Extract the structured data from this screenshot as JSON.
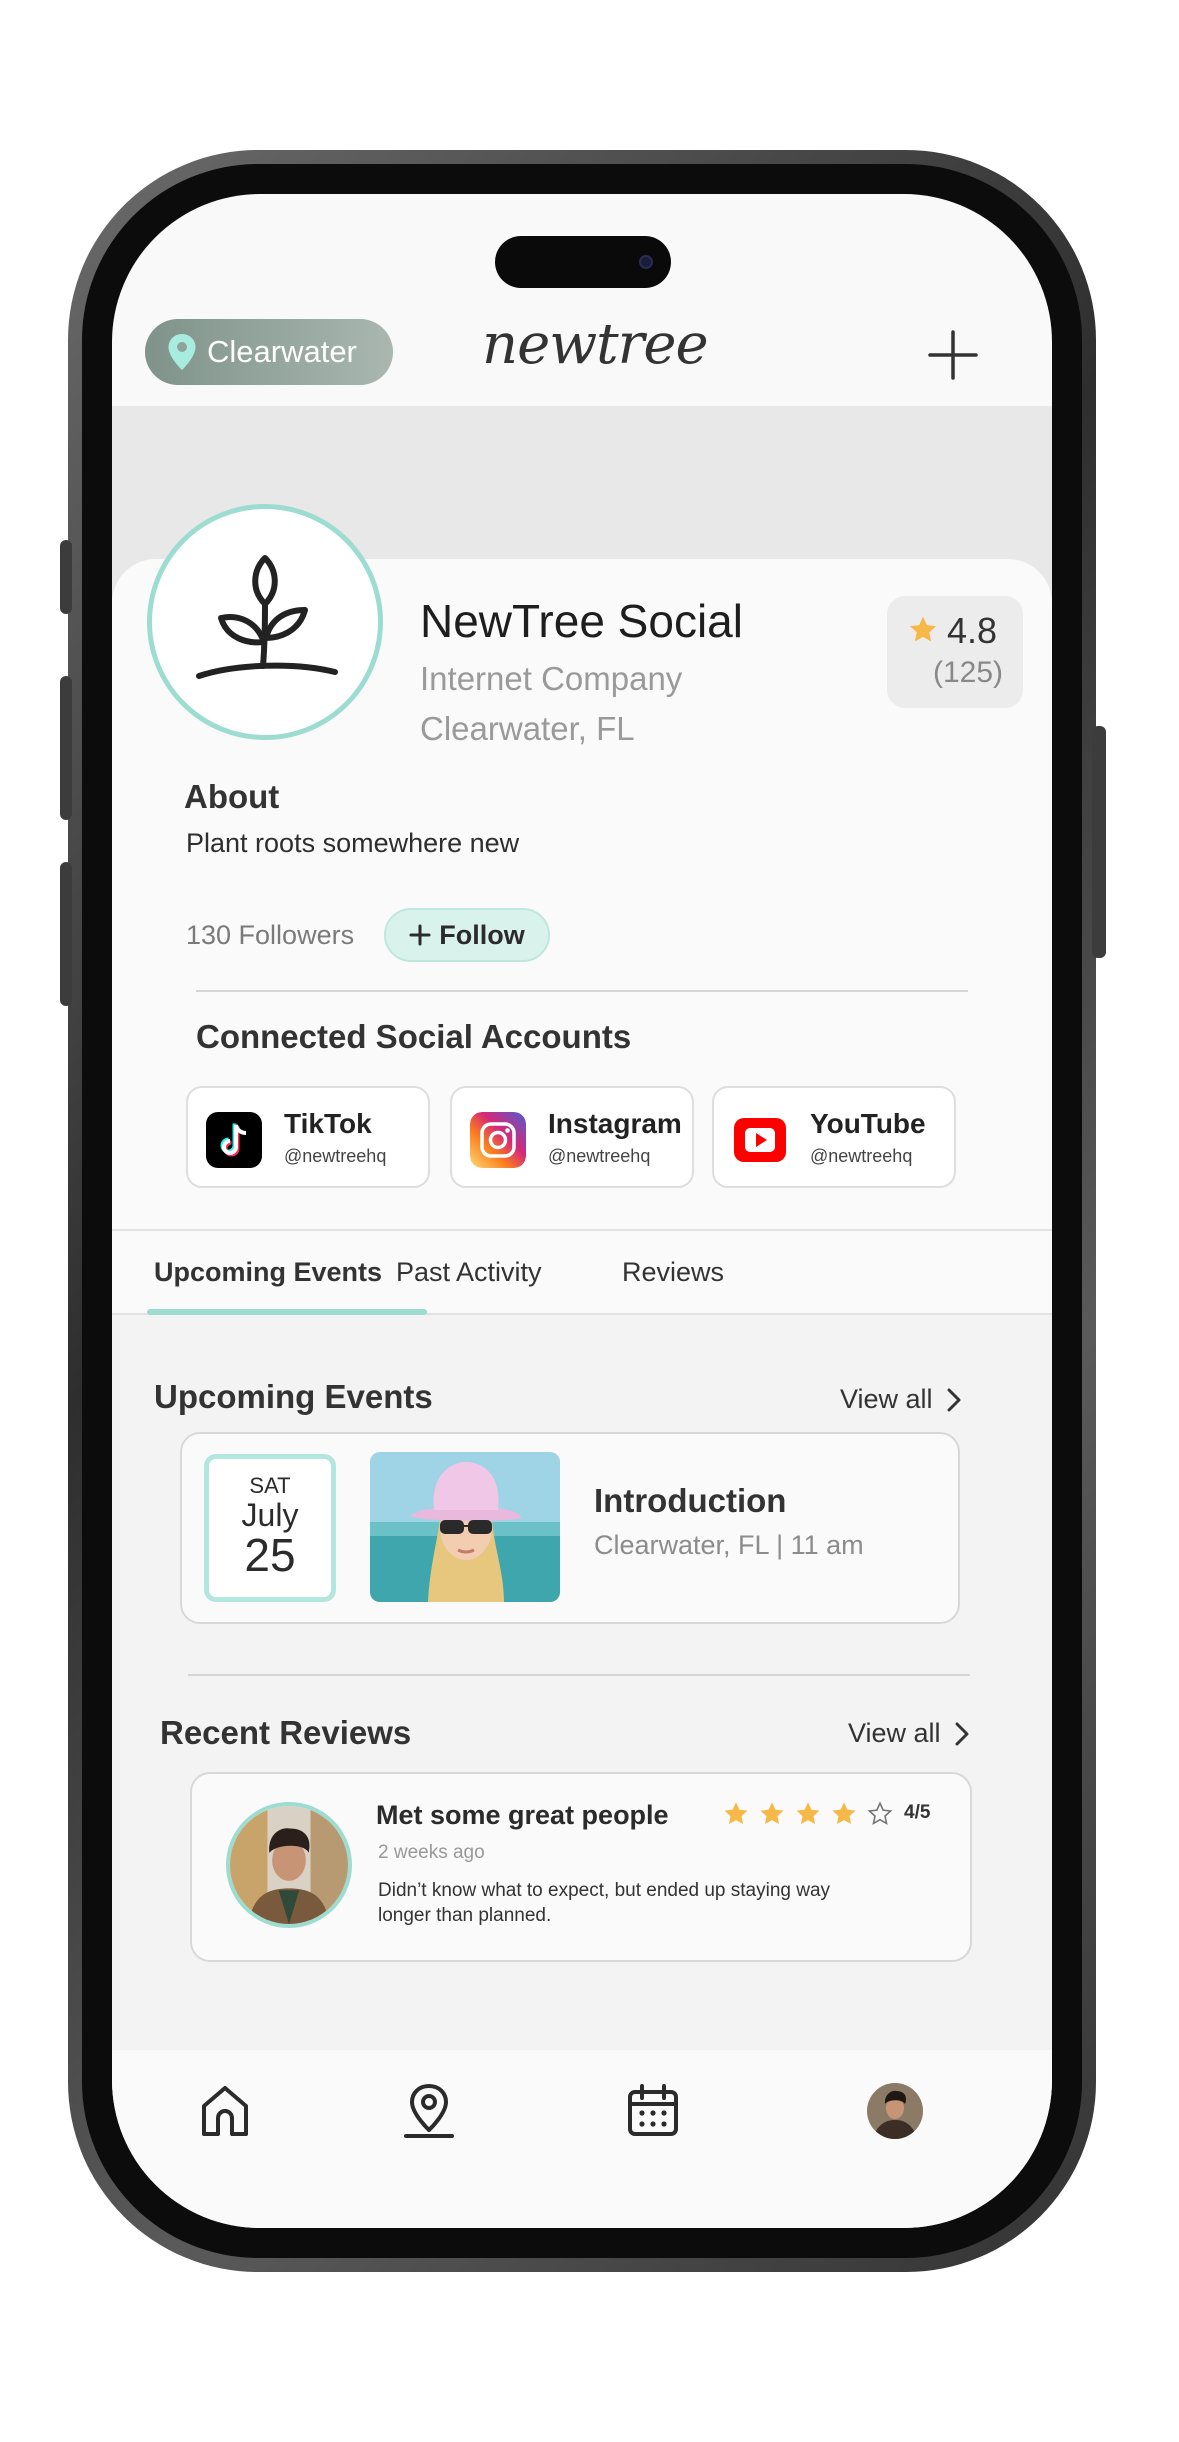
{
  "header": {
    "location": "Clearwater",
    "brand": "newtree"
  },
  "profile": {
    "name": "NewTree Social",
    "category": "Internet Company",
    "location": "Clearwater, FL",
    "rating": "4.8",
    "rating_count": "(125)",
    "about_heading": "About",
    "about_text": "Plant roots somewhere new",
    "followers": "130 Followers",
    "follow_label": "Follow"
  },
  "social": {
    "heading": "Connected Social Accounts",
    "accounts": [
      {
        "name": "TikTok",
        "handle": "@newtreehq",
        "icon": "tiktok-icon"
      },
      {
        "name": "Instagram",
        "handle": "@newtreehq",
        "icon": "instagram-icon"
      },
      {
        "name": "YouTube",
        "handle": "@newtreehq",
        "icon": "youtube-icon"
      }
    ]
  },
  "tabs": [
    {
      "label": "Upcoming Events",
      "active": true
    },
    {
      "label": "Past Activity",
      "active": false
    },
    {
      "label": "Reviews",
      "active": false
    }
  ],
  "events": {
    "heading": "Upcoming Events",
    "view_all": "View all",
    "items": [
      {
        "dow": "SAT",
        "month": "July",
        "day": "25",
        "title": "Introduction",
        "meta": "Clearwater, FL | 11 am"
      }
    ]
  },
  "reviews": {
    "heading": "Recent Reviews",
    "view_all": "View all",
    "items": [
      {
        "title": "Met some great people",
        "time": "2 weeks ago",
        "body": "Didn’t know what to expect, but ended up staying way longer than planned.",
        "stars": 4,
        "max": 5,
        "score": "4/5"
      }
    ]
  },
  "colors": {
    "accent": "#9ddcd0",
    "star": "#f6b847",
    "pill": "#8fa39b"
  },
  "tabbar": [
    "home-icon",
    "map-pin-icon",
    "calendar-icon",
    "profile-avatar"
  ]
}
